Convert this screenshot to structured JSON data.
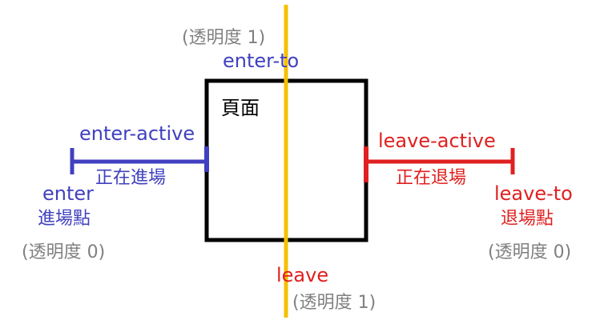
{
  "colors": {
    "enter": "#4040c0",
    "leave": "#e02020",
    "center_line": "#f5c000",
    "box": "#000000",
    "muted": "#808080",
    "text": "#000000"
  },
  "box": {
    "label": "頁面"
  },
  "center": {
    "top_opacity": "(透明度 1)",
    "top_label": "enter-to",
    "bottom_label": "leave",
    "bottom_opacity": "(透明度 1)"
  },
  "enter_side": {
    "active_label": "enter-active",
    "active_desc": "正在進場",
    "point_label": "enter",
    "point_desc": "進場點",
    "opacity": "(透明度 0)"
  },
  "leave_side": {
    "active_label": "leave-active",
    "active_desc": "正在退場",
    "point_label": "leave-to",
    "point_desc": "退場點",
    "opacity": "(透明度 0)"
  }
}
